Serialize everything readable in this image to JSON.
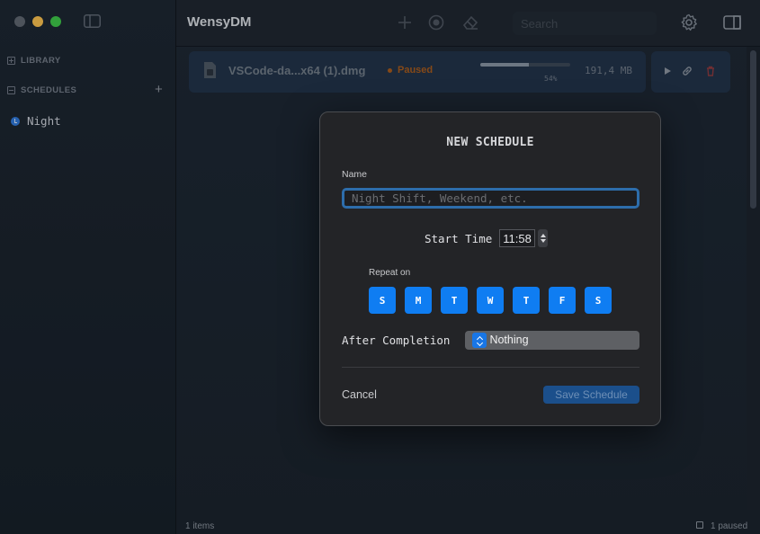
{
  "app": {
    "title": "WensyDM"
  },
  "sidebar": {
    "library_label": "LIBRARY",
    "schedules_label": "SCHEDULES",
    "schedules": [
      {
        "label": "Night"
      }
    ]
  },
  "toolbar": {
    "search_placeholder": "Search",
    "icons": [
      "plus-icon",
      "record-icon",
      "eraser-icon",
      "gear-icon",
      "panel-icon"
    ]
  },
  "downloads": [
    {
      "file_name": "VSCode-da...x64 (1).dmg",
      "status": "Paused",
      "progress_percent": 54,
      "progress_label": "54%",
      "size": "191,4 MB"
    }
  ],
  "footer": {
    "items_count": "1 items",
    "paused_count": "1 paused"
  },
  "modal": {
    "title": "NEW SCHEDULE",
    "name_label": "Name",
    "name_value": "",
    "name_placeholder": "Night Shift, Weekend, etc.",
    "start_time_label": "Start Time",
    "start_time_value": "11:58",
    "repeat_label": "Repeat on",
    "days": [
      "S",
      "M",
      "T",
      "W",
      "T",
      "F",
      "S"
    ],
    "after_completion_label": "After Completion",
    "after_completion_value": "Do Nothing",
    "cancel_label": "Cancel",
    "save_label": "Save Schedule"
  },
  "colors": {
    "accent": "#0f7df2",
    "paused_status": "#a45a1d",
    "traffic_min": "#f6be4f",
    "traffic_max": "#3ec449"
  }
}
